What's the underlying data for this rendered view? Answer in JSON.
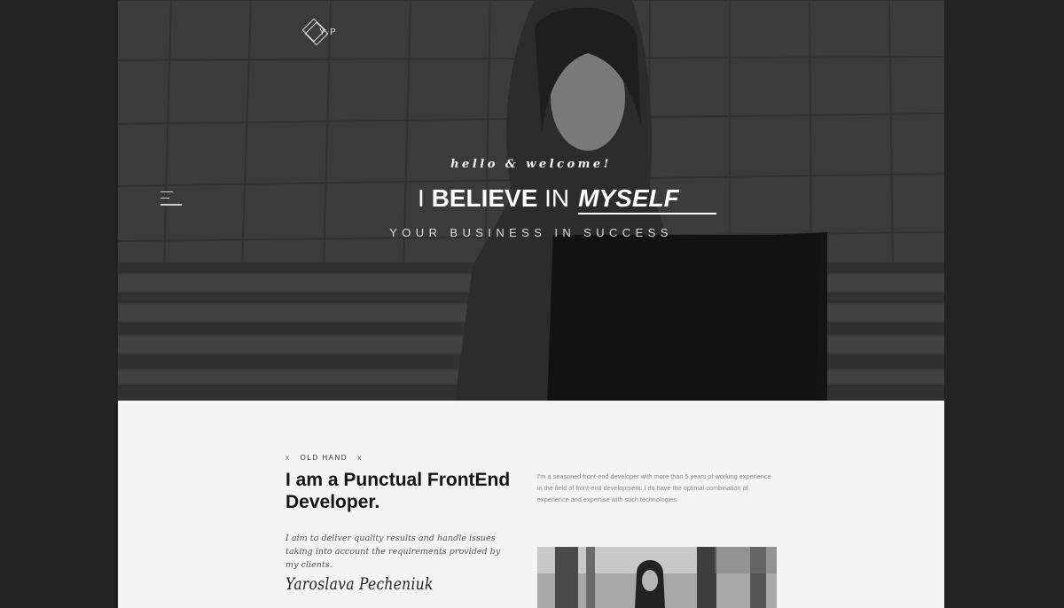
{
  "brand": {
    "logo_text": "Y.P"
  },
  "hero": {
    "greeting": "hello & welcome!",
    "headline_part1": "I ",
    "headline_bold": "BELIEVE",
    "headline_part2": " IN",
    "headline_emphasis": "MYSELF",
    "tagline": "YOUR BUSINESS IN SUCCESS"
  },
  "about": {
    "eyebrow": "OLD HAND",
    "eyebrow_marker": "x",
    "title": "I am a Punctual FrontEnd Developer.",
    "quote": "I aim to deliver quality results and handle issues taking into account the requirements provided by my clients.",
    "signature": "Yaroslava Pecheniuk",
    "description": "I'm a seasoned front-end developer with more than 5 years of working experience in the field of front-end development. I do have the optimal combination of experience and expertise with such technologies:"
  },
  "icons": {
    "logo": "diamond-logo-icon",
    "menu": "hamburger-menu-icon"
  },
  "colors": {
    "page_bg": "#232323",
    "content_bg": "#f4f4f4",
    "hero_overlay": "#3d3d3d",
    "text_dark": "#141414"
  }
}
